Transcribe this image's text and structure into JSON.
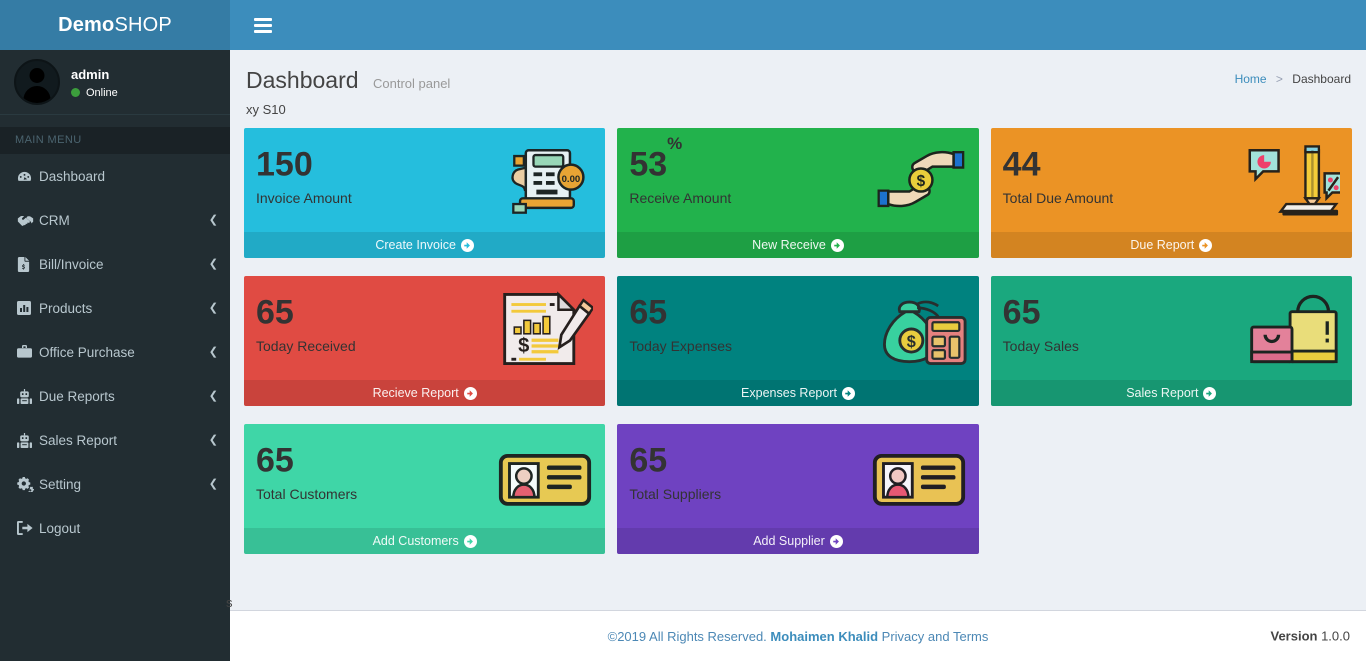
{
  "brand": {
    "bold": "Demo",
    "light": "SHOP"
  },
  "navbar": {
    "toggle_label": "Toggle navigation",
    "toggle_icon": "hamburger-icon"
  },
  "sidebar": {
    "user": {
      "name": "admin",
      "status": "Online",
      "avatar_icon": "user-avatar-icon"
    },
    "menu_header": "MAIN MENU",
    "items": [
      {
        "label": "Dashboard",
        "icon": "dashboard-icon",
        "caret": "",
        "has_caret": false
      },
      {
        "label": "CRM",
        "icon": "handshake-icon",
        "caret": "❮",
        "has_caret": true
      },
      {
        "label": "Bill/Invoice",
        "icon": "invoice-file-icon",
        "caret": "❮",
        "has_caret": true
      },
      {
        "label": "Products",
        "icon": "chart-bar-icon",
        "caret": "❮",
        "has_caret": true
      },
      {
        "label": "Office Purchase",
        "icon": "briefcase-icon",
        "caret": "❮",
        "has_caret": true
      },
      {
        "label": "Due Reports",
        "icon": "robot-icon",
        "caret": "❮",
        "has_caret": true
      },
      {
        "label": "Sales Report",
        "icon": "robot-icon",
        "caret": "❮",
        "has_caret": true
      },
      {
        "label": "Setting",
        "icon": "gears-icon",
        "caret": "❮",
        "has_caret": true
      },
      {
        "label": "Logout",
        "icon": "logout-icon",
        "caret": "",
        "has_caret": false
      }
    ]
  },
  "header": {
    "title": "Dashboard",
    "subtitle": "Control panel",
    "clipped_text": "xy S10",
    "breadcrumb": {
      "home": "Home",
      "separator": ">",
      "current": "Dashboard"
    }
  },
  "cards": [
    {
      "value": "150",
      "suffix": "",
      "label": "Invoice Amount",
      "footer": "Create Invoice",
      "bg": "#25bedd",
      "icon": "invoice-machine-icon"
    },
    {
      "value": "53",
      "suffix": "%",
      "label": "Receive Amount",
      "footer": "New Receive",
      "bg": "#22b24c",
      "icon": "hands-money-icon"
    },
    {
      "value": "44",
      "suffix": "",
      "label": "Total Due Amount",
      "footer": "Due Report",
      "bg": "#eb9325",
      "icon": "pencil-percent-icon"
    },
    {
      "value": "65",
      "suffix": "",
      "label": "Today Received",
      "footer": "Recieve Report",
      "bg": "#e04b43",
      "icon": "report-dollar-icon"
    },
    {
      "value": "65",
      "suffix": "",
      "label": "Today Expenses",
      "footer": "Expenses Report",
      "bg": "#00827f",
      "icon": "money-bag-calculator-icon"
    },
    {
      "value": "65",
      "suffix": "",
      "label": "Today Sales",
      "footer": "Sales Report",
      "bg": "#1aa87e",
      "icon": "shopping-bags-icon"
    },
    {
      "value": "65",
      "suffix": "",
      "label": "Total Customers",
      "footer": "Add Customers",
      "bg": "#3fd6a7",
      "icon": "id-card-icon"
    },
    {
      "value": "65",
      "suffix": "",
      "label": "Total Suppliers",
      "footer": "Add Supplier",
      "bg": "#6f42c1",
      "icon": "id-card-icon"
    }
  ],
  "footer": {
    "copyright": "©2019 All Rights Reserved.",
    "author": "Mohaimen Khalid",
    "terms": "Privacy and Terms",
    "version_label": "Version",
    "version_number": "1.0.0",
    "clipped_text": "s"
  }
}
